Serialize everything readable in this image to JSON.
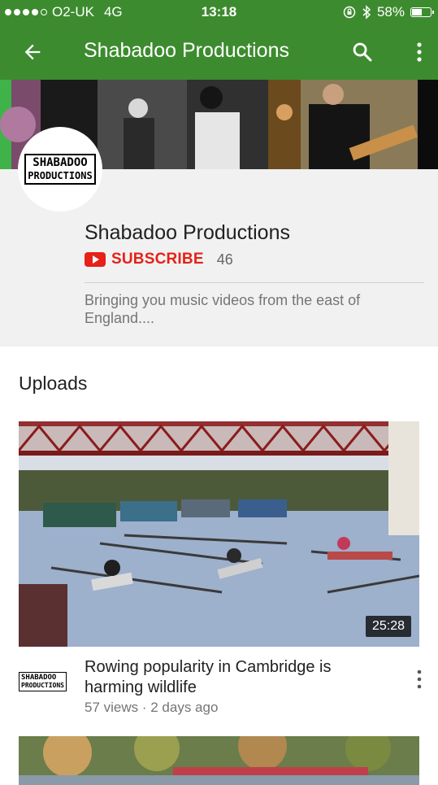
{
  "status_bar": {
    "carrier": "O2-UK",
    "network": "4G",
    "time": "13:18",
    "battery_percent": "58%",
    "battery_level": 0.58,
    "icons": [
      "signal-dots-icon",
      "lock-rotation-icon",
      "bluetooth-icon",
      "battery-icon"
    ]
  },
  "app_bar": {
    "title": "Shabadoo Productions",
    "icons": [
      "back-arrow-icon",
      "search-icon",
      "more-vertical-icon"
    ],
    "color": "#3d8b2f"
  },
  "channel": {
    "logo_line1": "SHABADOO",
    "logo_line2": "PRODUCTIONS",
    "name": "Shabadoo Productions",
    "subscribe_label": "SUBSCRIBE",
    "subscriber_count": "46",
    "description": "Bringing you music videos from the east of England....",
    "subscribe_color": "#e62117"
  },
  "uploads": {
    "heading": "Uploads",
    "videos": [
      {
        "title": "Rowing popularity in Cambridge is harming wildlife",
        "meta": "57 views · 2 days ago",
        "duration": "25:28",
        "channel_logo_line1": "SHABADOO",
        "channel_logo_line2": "PRODUCTIONS"
      }
    ]
  }
}
